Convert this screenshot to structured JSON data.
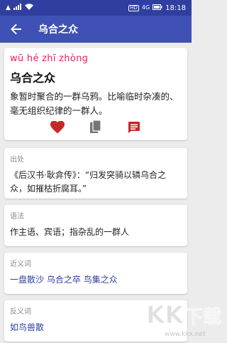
{
  "status_bar": {
    "time": "18:18",
    "signal": "4G",
    "hd": "HD"
  },
  "app_bar": {
    "title": "乌合之众"
  },
  "entry": {
    "pinyin": "wū hé zhī zhòng",
    "idiom": "乌合之众",
    "explanation": "象暂时聚合的一群乌鸦。比喻临时杂凑的、毫无组织纪律的一群人。"
  },
  "source": {
    "label": "出处",
    "text": "《后汉书·耿弇传》：“归发突骑以辚乌合之众，如摧枯折腐耳。”"
  },
  "usage": {
    "label": "语法",
    "text": "作主语、宾语；指杂乱的一群人"
  },
  "synonyms": {
    "label": "近义词",
    "items": [
      "一盘散沙",
      "乌合之卒",
      "鸟集之众"
    ]
  },
  "antonyms": {
    "label": "反义词",
    "items": [
      "如鸟兽散"
    ]
  },
  "watermark": {
    "brand": "KK下载",
    "url": "www.kkx.net"
  },
  "colors": {
    "status_bar": "#303f9f",
    "app_bar": "#3f51b5",
    "accent": "#e91e63",
    "action_red": "#c62828",
    "link": "#303f9f"
  }
}
